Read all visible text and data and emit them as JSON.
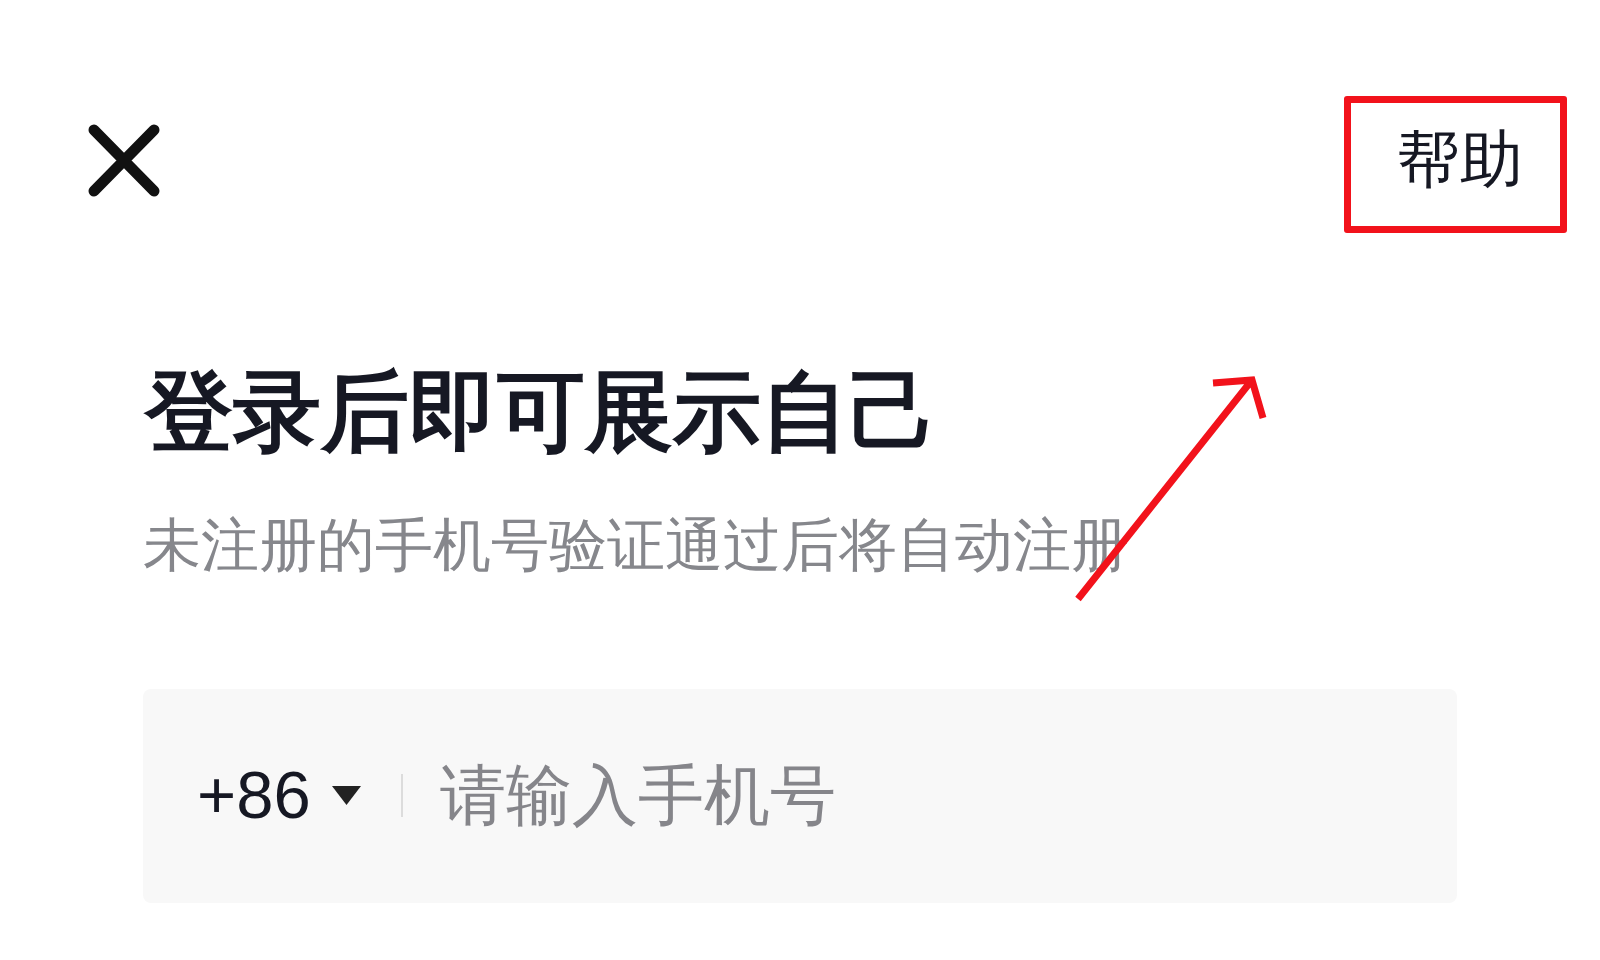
{
  "header": {
    "help_button": {
      "label": "帮助",
      "highlighted": true
    }
  },
  "title": "登录后即可展示自己",
  "subtitle": "未注册的手机号验证通过后将自动注册",
  "phone_field": {
    "country_code": "+86",
    "placeholder": "请输入手机号"
  },
  "annotation_arrow": true
}
